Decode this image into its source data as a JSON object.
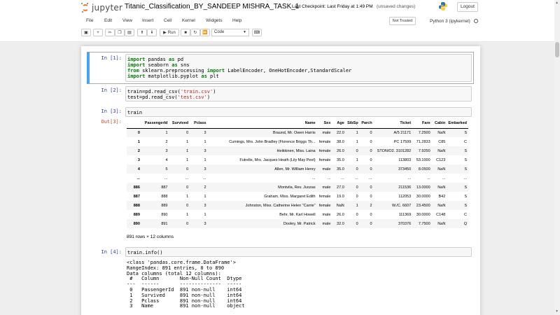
{
  "header": {
    "logo_text": "jupyter",
    "notebook_title": "Titanic_Classification_BY_SANDEEP MISHRA_TASK_1",
    "checkpoint": "Last Checkpoint: Last Friday at 1:49 PM",
    "autosave_status": "(unsaved changes)",
    "logout_label": "Logout"
  },
  "menubar": {
    "items": [
      "File",
      "Edit",
      "View",
      "Insert",
      "Cell",
      "Kernel",
      "Widgets",
      "Help"
    ],
    "trusted_label": "Not Trusted",
    "kernel_name": "Python 3 (ipykernel)"
  },
  "toolbar": {
    "run_label": "Run",
    "cell_type": "Code",
    "icons": [
      "save-icon",
      "plus-icon",
      "cut-icon",
      "copy-icon",
      "paste-icon",
      "arrow-up-icon",
      "arrow-down-icon",
      "play-icon",
      "stop-icon",
      "restart-icon",
      "fast-forward-icon",
      "keyboard-icon"
    ]
  },
  "cells": {
    "c1": {
      "prompt": "In [1]:"
    },
    "c2": {
      "prompt": "In [2]:"
    },
    "c3": {
      "prompt": "In [3]:",
      "code": "train",
      "out_prompt": "Out[3]:"
    },
    "c4": {
      "prompt": "In [4]:",
      "code": "train.info()"
    }
  },
  "dataframe": {
    "columns": [
      "",
      "PassengerId",
      "Survived",
      "Pclass",
      "Name",
      "Sex",
      "Age",
      "SibSp",
      "Parch",
      "Ticket",
      "Fare",
      "Cabin",
      "Embarked"
    ],
    "rows": [
      [
        "0",
        "1",
        "0",
        "3",
        "Braund, Mr. Owen Harris",
        "male",
        "22.0",
        "1",
        "0",
        "A/5 21171",
        "7.2500",
        "NaN",
        "S"
      ],
      [
        "1",
        "2",
        "1",
        "1",
        "Cumings, Mrs. John Bradley (Florence Briggs Th...",
        "female",
        "38.0",
        "1",
        "0",
        "PC 17599",
        "71.2833",
        "C85",
        "C"
      ],
      [
        "2",
        "3",
        "1",
        "3",
        "Heikkinen, Miss. Laina",
        "female",
        "26.0",
        "0",
        "0",
        "STON/O2. 3101282",
        "7.9250",
        "NaN",
        "S"
      ],
      [
        "3",
        "4",
        "1",
        "1",
        "Futrelle, Mrs. Jacques Heath (Lily May Peel)",
        "female",
        "35.0",
        "1",
        "0",
        "113803",
        "53.1000",
        "C123",
        "S"
      ],
      [
        "4",
        "5",
        "0",
        "3",
        "Allen, Mr. William Henry",
        "male",
        "35.0",
        "0",
        "0",
        "373450",
        "8.0500",
        "NaN",
        "S"
      ],
      [
        "...",
        "...",
        "...",
        "...",
        "...",
        "...",
        "...",
        "...",
        "...",
        "...",
        "...",
        "...",
        "..."
      ],
      [
        "886",
        "887",
        "0",
        "2",
        "Montvila, Rev. Juozas",
        "male",
        "27.0",
        "0",
        "0",
        "211536",
        "13.0000",
        "NaN",
        "S"
      ],
      [
        "887",
        "888",
        "1",
        "1",
        "Graham, Miss. Margaret Edith",
        "female",
        "19.0",
        "0",
        "0",
        "112053",
        "30.0000",
        "B42",
        "S"
      ],
      [
        "888",
        "889",
        "0",
        "3",
        "Johnston, Miss. Catherine Helen \"Carrie\"",
        "female",
        "NaN",
        "1",
        "2",
        "W./C. 6607",
        "23.4500",
        "NaN",
        "S"
      ],
      [
        "889",
        "890",
        "1",
        "1",
        "Behr, Mr. Karl Howell",
        "male",
        "26.0",
        "0",
        "0",
        "111369",
        "30.0000",
        "C148",
        "C"
      ],
      [
        "890",
        "891",
        "0",
        "3",
        "Dooley, Mr. Patrick",
        "male",
        "32.0",
        "0",
        "0",
        "370376",
        "7.7500",
        "NaN",
        "Q"
      ]
    ],
    "footer": "891 rows × 12 columns"
  },
  "info_output": [
    "<class 'pandas.core.frame.DataFrame'>",
    "RangeIndex: 891 entries, 0 to 890",
    "Data columns (total 12 columns):",
    " #   Column       Non-Null Count  Dtype ",
    "---  ------       --------------  ----- ",
    " 0   PassengerId  891 non-null    int64 ",
    " 1   Survived     891 non-null    int64 ",
    " 2   Pclass       891 non-null    int64 ",
    " 3   Name         891 non-null    object"
  ],
  "colors": {
    "accent_selected": "#42a5f5",
    "in_prompt": "#303f9f",
    "out_prompt": "#d84315",
    "keyword": "#008000",
    "string": "#ba2121"
  }
}
